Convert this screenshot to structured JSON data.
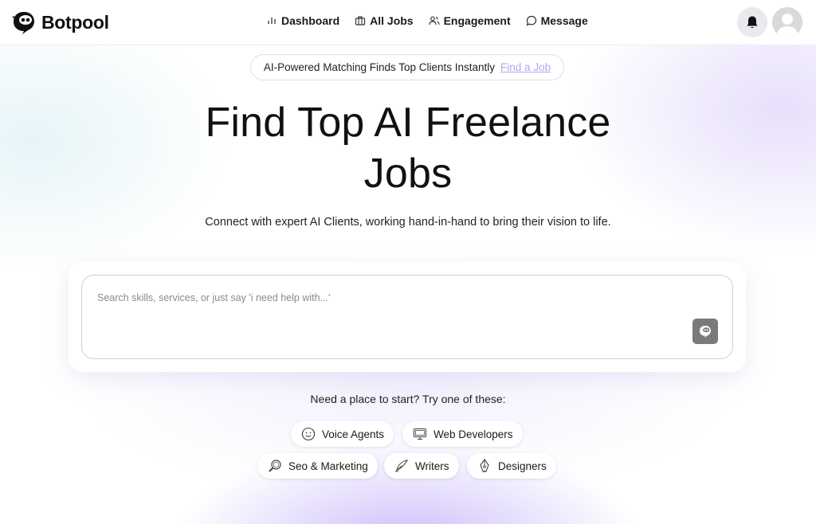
{
  "brand": {
    "name": "Botpool"
  },
  "nav": {
    "items": [
      {
        "label": "Dashboard",
        "icon": "bar-chart-icon"
      },
      {
        "label": "All Jobs",
        "icon": "briefcase-icon"
      },
      {
        "label": "Engagement",
        "icon": "users-icon"
      },
      {
        "label": "Message",
        "icon": "chat-bubble-icon"
      }
    ]
  },
  "header": {
    "notifications_icon": "bell-icon",
    "avatar_icon": "user-avatar-icon"
  },
  "announcement": {
    "text": "AI-Powered Matching Finds Top Clients Instantly",
    "link": "Find a Job"
  },
  "hero": {
    "title_line1": "Find Top AI Freelance",
    "title_line2": "Jobs",
    "subtitle": "Connect with expert AI Clients, working hand-in-hand to bring their vision to life."
  },
  "search": {
    "placeholder": "Search skills, services, or just say 'i need help with...'",
    "value": ""
  },
  "suggestions": {
    "label": "Need a place to start? Try one of these:",
    "chips": [
      {
        "label": "Voice Agents",
        "icon": "smiley-icon"
      },
      {
        "label": "Web Developers",
        "icon": "monitor-icon"
      },
      {
        "label": "Seo & Marketing",
        "icon": "magnifier-icon"
      },
      {
        "label": "Writers",
        "icon": "feather-pen-icon"
      },
      {
        "label": "Designers",
        "icon": "design-pen-icon"
      }
    ]
  },
  "colors": {
    "accent_link": "#b9a3f0",
    "send_button": "#7a7a7a",
    "glow": "#bea9fa"
  }
}
